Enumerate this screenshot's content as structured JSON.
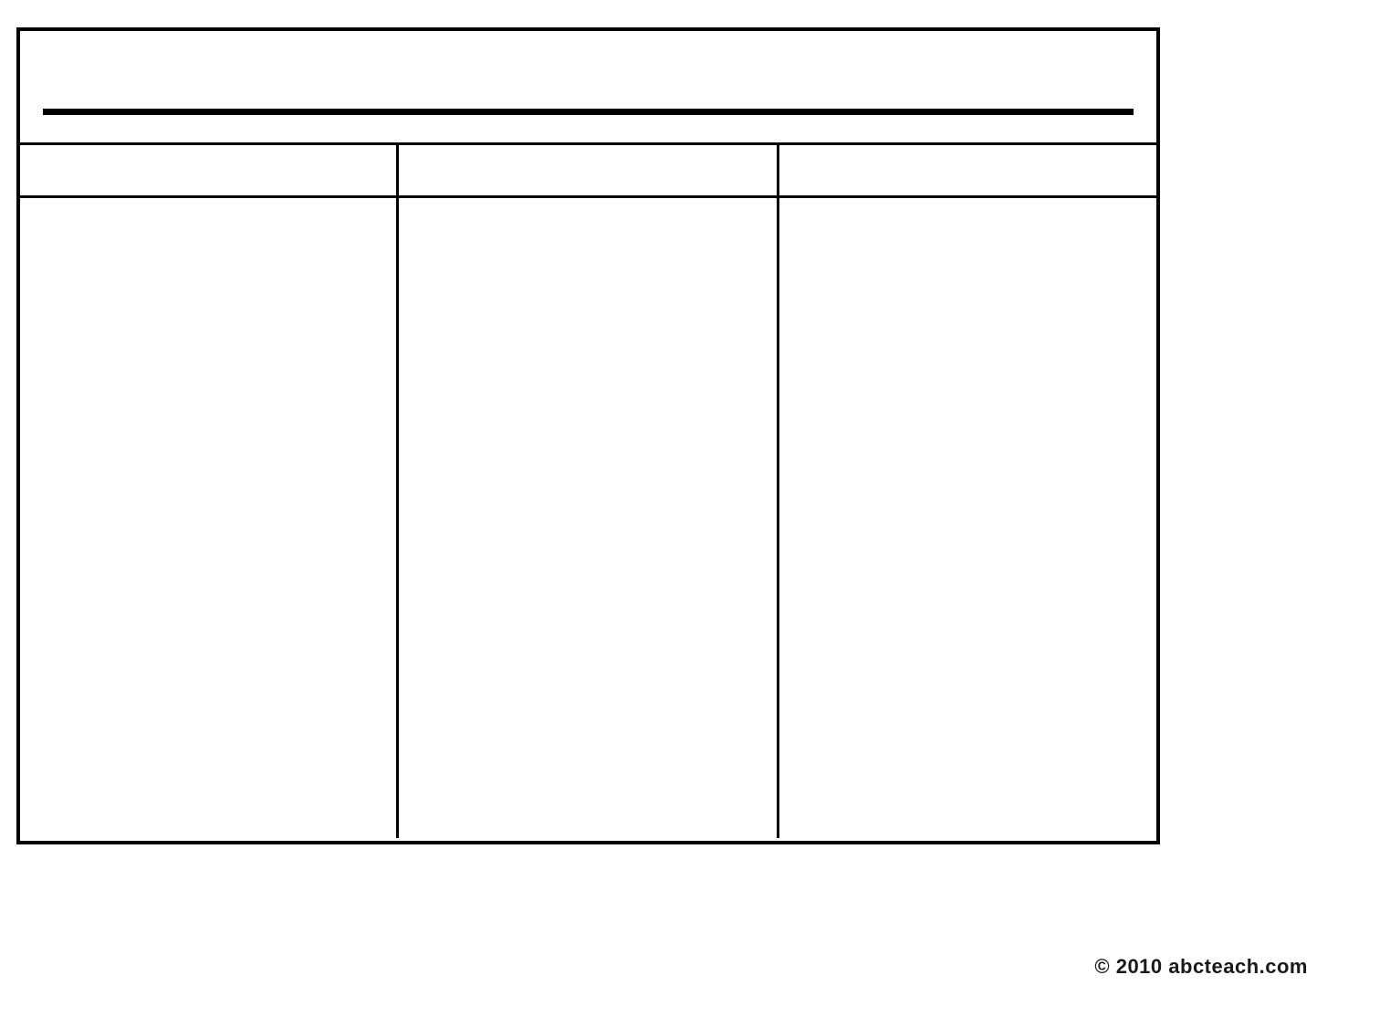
{
  "chart": {
    "title": "",
    "columns": {
      "header1": "",
      "header2": "",
      "header3": "",
      "body1": "",
      "body2": "",
      "body3": ""
    }
  },
  "footer": {
    "copyright": "© 2010 abcteach.com"
  }
}
